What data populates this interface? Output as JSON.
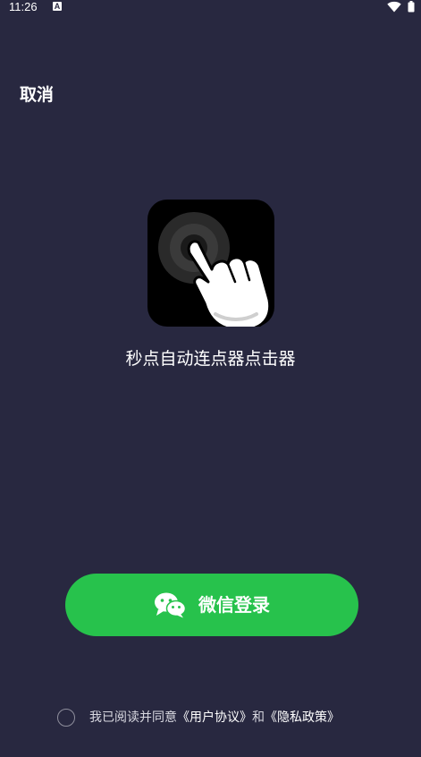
{
  "status_bar": {
    "time": "11:26",
    "notification_icon": "a-icon",
    "wifi_icon": "wifi-icon",
    "battery_icon": "battery-icon"
  },
  "header": {
    "cancel_label": "取消"
  },
  "app": {
    "icon": "tap-hand-icon",
    "name": "秒点自动连点器点击器"
  },
  "login": {
    "wechat_icon": "wechat-icon",
    "wechat_label": "微信登录"
  },
  "agreement": {
    "prefix": "我已阅读并同意",
    "user_agreement": "《用户协议》",
    "and": "和",
    "privacy_policy": "《隐私政策》"
  },
  "colors": {
    "background": "#282840",
    "accent_green": "#27c24c",
    "text": "#ffffff"
  }
}
